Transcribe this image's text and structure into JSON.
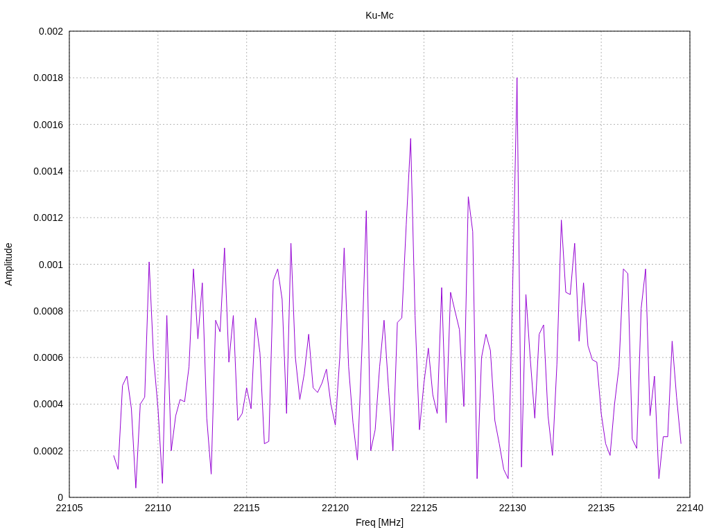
{
  "chart_data": {
    "type": "line",
    "grid": true,
    "title": "Ku-Mc",
    "xlabel": "Freq [MHz]",
    "ylabel": "Amplitude",
    "xlim": [
      22105,
      22140
    ],
    "ylim": [
      0,
      0.002
    ],
    "xticks": [
      22105,
      22110,
      22115,
      22120,
      22125,
      22130,
      22135,
      22140
    ],
    "yticks": [
      0,
      0.0002,
      0.0004,
      0.0006,
      0.0008,
      0.001,
      0.0012,
      0.0014,
      0.0016,
      0.0018,
      0.002
    ],
    "x": [
      22107.5,
      22107.75,
      22108,
      22108.25,
      22108.5,
      22108.75,
      22109,
      22109.25,
      22109.5,
      22109.75,
      22110,
      22110.25,
      22110.5,
      22110.75,
      22111,
      22111.25,
      22111.5,
      22111.75,
      22112,
      22112.25,
      22112.5,
      22112.75,
      22113,
      22113.25,
      22113.5,
      22113.75,
      22114,
      22114.25,
      22114.5,
      22114.75,
      22115,
      22115.25,
      22115.5,
      22115.75,
      22116,
      22116.25,
      22116.5,
      22116.75,
      22117,
      22117.25,
      22117.5,
      22117.75,
      22118,
      22118.25,
      22118.5,
      22118.75,
      22119,
      22119.25,
      22119.5,
      22119.75,
      22120,
      22120.25,
      22120.5,
      22120.75,
      22121,
      22121.25,
      22121.5,
      22121.75,
      22122,
      22122.25,
      22122.5,
      22122.75,
      22123,
      22123.25,
      22123.5,
      22123.75,
      22124,
      22124.25,
      22124.5,
      22124.75,
      22125,
      22125.25,
      22125.5,
      22125.75,
      22126,
      22126.25,
      22126.5,
      22126.75,
      22127,
      22127.25,
      22127.5,
      22127.75,
      22128,
      22128.25,
      22128.5,
      22128.75,
      22129,
      22129.25,
      22129.5,
      22129.75,
      22130,
      22130.25,
      22130.5,
      22130.75,
      22131,
      22131.25,
      22131.5,
      22131.75,
      22132,
      22132.25,
      22132.5,
      22132.75,
      22133,
      22133.25,
      22133.5,
      22133.75,
      22134,
      22134.25,
      22134.5,
      22134.75,
      22135,
      22135.25,
      22135.5,
      22135.75,
      22136,
      22136.25,
      22136.5,
      22136.75,
      22137,
      22137.25,
      22137.5,
      22137.75,
      22138,
      22138.25,
      22138.5,
      22138.75,
      22139,
      22139.25,
      22139.5
    ],
    "series": [
      {
        "color": "#9400d3",
        "values": [
          0.00018,
          0.00012,
          0.00048,
          0.00052,
          0.00038,
          4e-05,
          0.0004,
          0.00043,
          0.00101,
          0.0006,
          0.00038,
          6e-05,
          0.00078,
          0.0002,
          0.00035,
          0.00042,
          0.00041,
          0.00056,
          0.00098,
          0.00068,
          0.00092,
          0.00034,
          0.0001,
          0.00076,
          0.00071,
          0.00107,
          0.00058,
          0.00078,
          0.00033,
          0.00036,
          0.00047,
          0.00038,
          0.00077,
          0.00062,
          0.00023,
          0.00024,
          0.00093,
          0.00098,
          0.00085,
          0.00036,
          0.00109,
          0.0006,
          0.00042,
          0.00053,
          0.0007,
          0.00047,
          0.00045,
          0.00049,
          0.00055,
          0.0004,
          0.00031,
          0.0006,
          0.00107,
          0.00056,
          0.00032,
          0.00016,
          0.00063,
          0.00123,
          0.0002,
          0.00029,
          0.00056,
          0.00076,
          0.00047,
          0.0002,
          0.00075,
          0.00077,
          0.00117,
          0.00154,
          0.00078,
          0.00029,
          0.00049,
          0.00064,
          0.00044,
          0.00036,
          0.0009,
          0.00032,
          0.00088,
          0.0008,
          0.00072,
          0.00039,
          0.00129,
          0.00114,
          8e-05,
          0.0006,
          0.0007,
          0.00063,
          0.00033,
          0.00023,
          0.00012,
          8e-05,
          0.00089,
          0.0018,
          0.00013,
          0.00087,
          0.00059,
          0.00034,
          0.0007,
          0.00074,
          0.00035,
          0.00018,
          0.00057,
          0.00119,
          0.00088,
          0.00087,
          0.00109,
          0.00067,
          0.00092,
          0.00065,
          0.00059,
          0.00058,
          0.00036,
          0.00023,
          0.00018,
          0.0004,
          0.00056,
          0.00098,
          0.00096,
          0.00025,
          0.00021,
          0.00081,
          0.00098,
          0.00035,
          0.00052,
          8e-05,
          0.00026,
          0.00026,
          0.00067,
          0.00043,
          0.00023
        ]
      }
    ]
  }
}
